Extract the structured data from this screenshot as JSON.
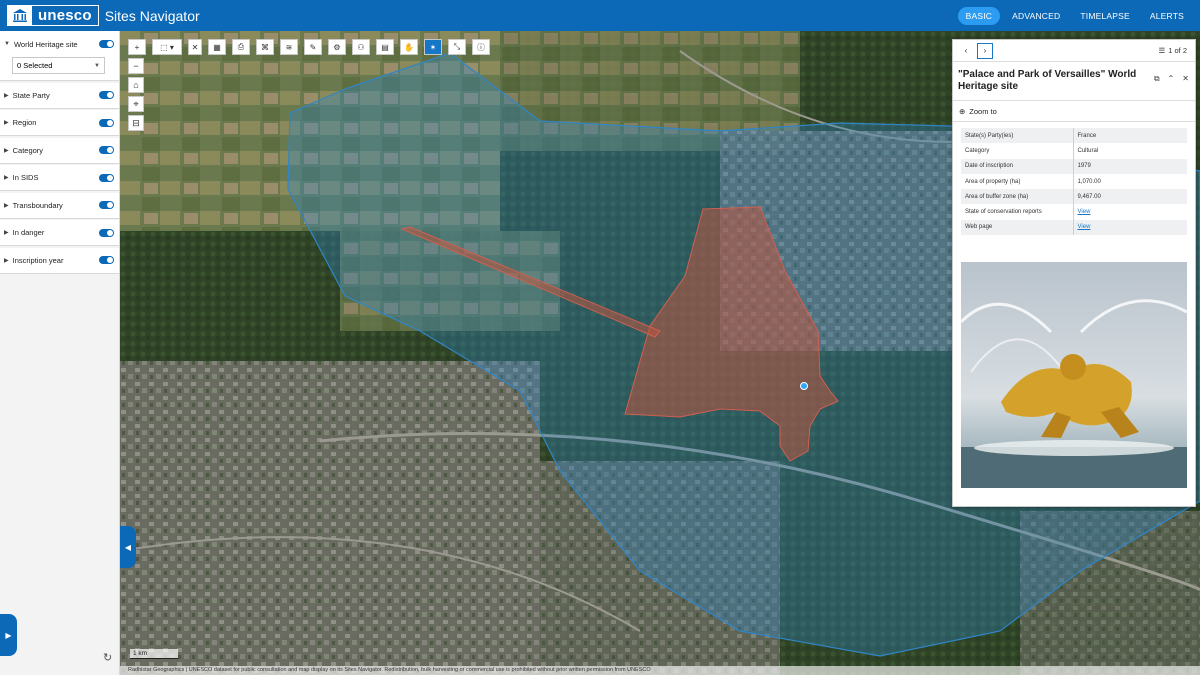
{
  "header": {
    "logo_text": "unesco",
    "app_title": "Sites Navigator",
    "modes": [
      "BASIC",
      "ADVANCED",
      "TIMELAPSE",
      "ALERTS"
    ],
    "active_mode": "BASIC"
  },
  "sidebar": {
    "top_filter": "World Heritage site",
    "selected_value": "0 Selected",
    "filters": [
      "State Party",
      "Region",
      "Category",
      "In SIDS",
      "Transboundary",
      "In danger",
      "Inscription year"
    ]
  },
  "map": {
    "scale_label": "1 km",
    "credits": "Radhistar Geographics | UNESCO dataset for public consultation and map display on its Sites Navigator. Redistribution, bulk harvesting or commercial use is prohibited without prior written permission from UNESCO",
    "colors": {
      "buffer_zone": "#2f86c8",
      "property": "#c0553f"
    }
  },
  "popup": {
    "pager": "1 of 2",
    "title": "\"Palace and Park of Versailles\" World Heritage site",
    "zoom_label": "Zoom to",
    "rows": [
      {
        "key": "State(s) Party(ies)",
        "value": "France"
      },
      {
        "key": "Category",
        "value": "Cultural"
      },
      {
        "key": "Date of inscription",
        "value": "1979"
      },
      {
        "key": "Area of property (ha)",
        "value": "1,070.00"
      },
      {
        "key": "Area of buffer zone (ha)",
        "value": "9,467.00"
      },
      {
        "key": "State of conservation reports",
        "value": "View"
      },
      {
        "key": "Web page",
        "value": "View"
      }
    ]
  }
}
